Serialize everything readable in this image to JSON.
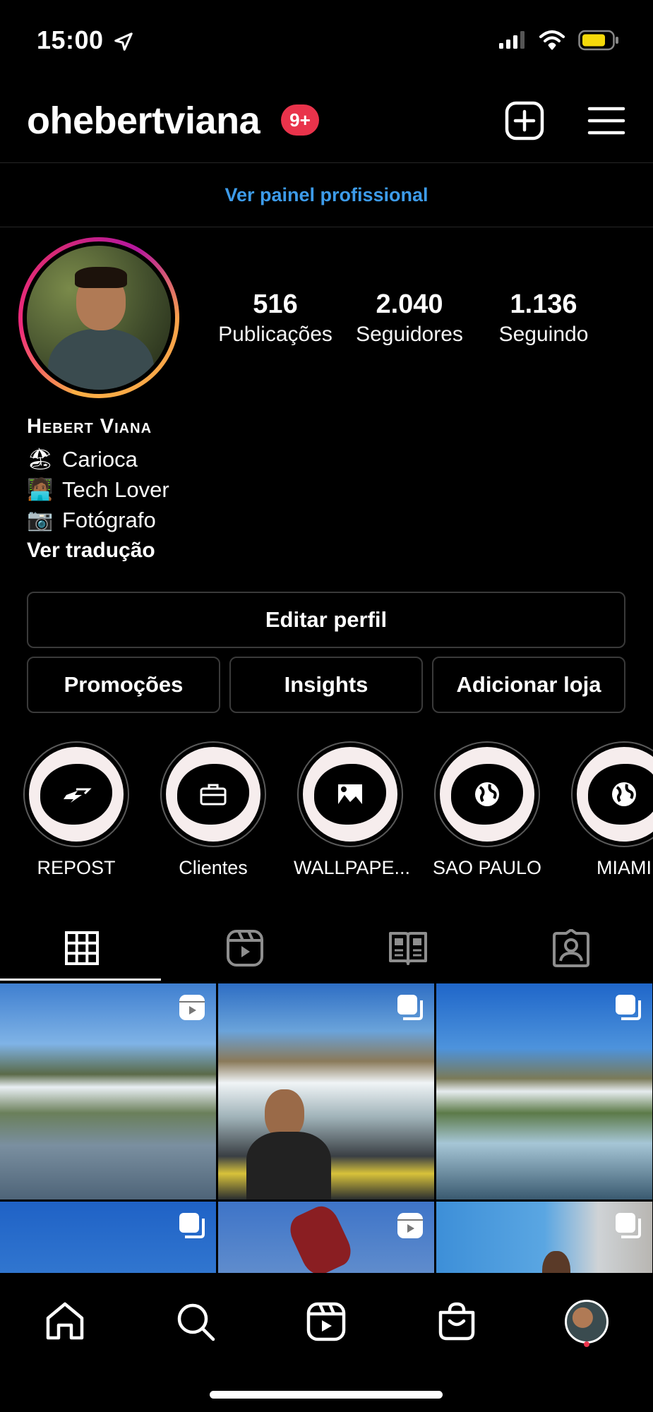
{
  "status_bar": {
    "time": "15:00",
    "battery_color": "#f5d90a"
  },
  "header": {
    "username": "ohebertviana",
    "notification_badge": "9+"
  },
  "professional_dashboard": {
    "label": "Ver painel profissional",
    "color": "#3d9be9"
  },
  "profile": {
    "stats": [
      {
        "value": "516",
        "label": "Publicações"
      },
      {
        "value": "2.040",
        "label": "Seguidores"
      },
      {
        "value": "1.136",
        "label": "Seguindo"
      }
    ],
    "name": "Hebert Viana",
    "bio_lines": [
      {
        "emoji": "🏖",
        "text": "Carioca"
      },
      {
        "emoji": "🧑🏾‍💻",
        "text": "Tech Lover"
      },
      {
        "emoji": "📷",
        "text": "Fotógrafo"
      }
    ],
    "see_translation": "Ver tradução"
  },
  "buttons": {
    "edit_profile": "Editar perfil",
    "promotions": "Promoções",
    "insights": "Insights",
    "add_shop": "Adicionar loja"
  },
  "highlights": [
    {
      "label": "REPOST",
      "icon": "repost-arrow-icon"
    },
    {
      "label": "Clientes",
      "icon": "briefcase-icon"
    },
    {
      "label": "WALLPAPE...",
      "icon": "wallpaper-icon"
    },
    {
      "label": "SAO PAULO",
      "icon": "globe-icon"
    },
    {
      "label": "MIAMI",
      "icon": "globe-icon"
    }
  ],
  "tabs": [
    {
      "name": "posts-grid",
      "icon": "grid-icon",
      "active": true
    },
    {
      "name": "reels",
      "icon": "reels-icon",
      "active": false
    },
    {
      "name": "guides",
      "icon": "guide-icon",
      "active": false
    },
    {
      "name": "tagged",
      "icon": "tagged-person-icon",
      "active": false
    }
  ],
  "posts": [
    {
      "type": "reel",
      "subject": "waterfalls-landscape"
    },
    {
      "type": "carousel",
      "subject": "man-at-waterfall"
    },
    {
      "type": "carousel",
      "subject": "waterfall-rapids"
    },
    {
      "type": "carousel",
      "subject": "cliff-sky"
    },
    {
      "type": "reel",
      "subject": "blurred-object"
    },
    {
      "type": "carousel",
      "subject": "window-portrait"
    }
  ],
  "bottom_nav": [
    {
      "name": "home",
      "icon": "home-icon"
    },
    {
      "name": "search",
      "icon": "search-icon"
    },
    {
      "name": "reels",
      "icon": "reels-icon"
    },
    {
      "name": "shop",
      "icon": "shopping-bag-icon"
    },
    {
      "name": "profile",
      "icon": "profile-avatar"
    }
  ]
}
